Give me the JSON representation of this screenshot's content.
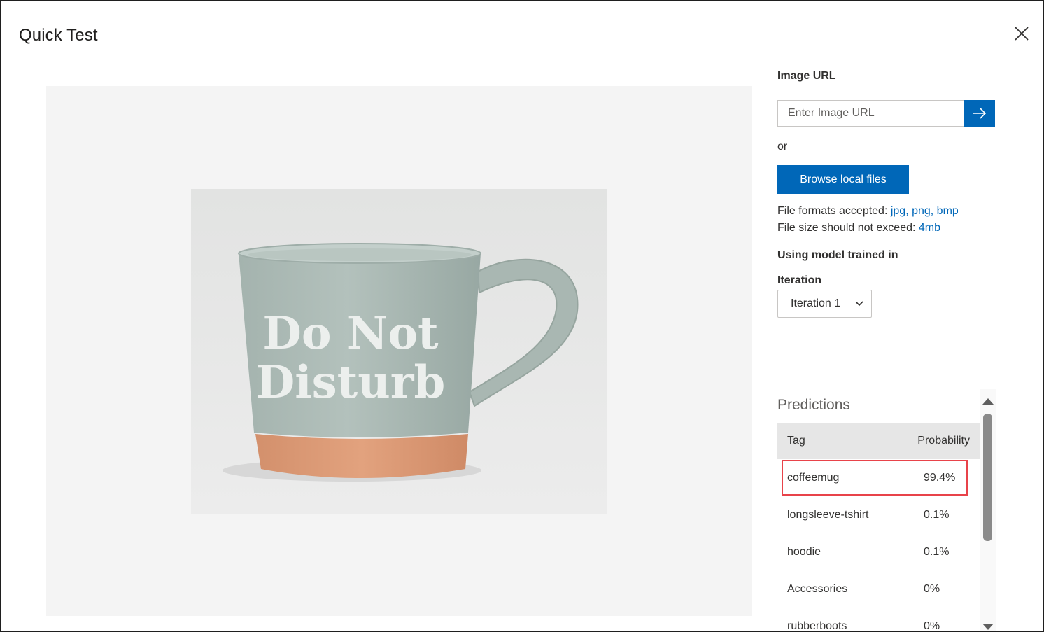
{
  "dialog": {
    "title": "Quick Test",
    "close_label": "Close"
  },
  "preview": {
    "mug_text_line1": "Do Not",
    "mug_text_line2": "Disturb"
  },
  "image_url": {
    "label": "Image URL",
    "placeholder": "Enter Image URL",
    "value": ""
  },
  "or_text": "or",
  "browse_button": "Browse local files",
  "file_info": {
    "formats_prefix": "File formats accepted: ",
    "formats": "jpg, png, bmp",
    "size_prefix": "File size should not exceed: ",
    "size": "4mb"
  },
  "model": {
    "heading": "Using model trained in",
    "iteration_label": "Iteration",
    "iteration_value": "Iteration 1"
  },
  "predictions": {
    "title": "Predictions",
    "columns": {
      "tag": "Tag",
      "probability": "Probability"
    },
    "rows": [
      {
        "tag": "coffeemug",
        "probability": "99.4%"
      },
      {
        "tag": "longsleeve-tshirt",
        "probability": "0.1%"
      },
      {
        "tag": "hoodie",
        "probability": "0.1%"
      },
      {
        "tag": "Accessories",
        "probability": "0%"
      },
      {
        "tag": "rubberboots",
        "probability": "0%"
      }
    ]
  },
  "colors": {
    "accent": "#0067b8",
    "highlight_border": "#e8434a",
    "table_header_bg": "#e6e6e6",
    "image_panel_bg": "#f4f4f4"
  }
}
